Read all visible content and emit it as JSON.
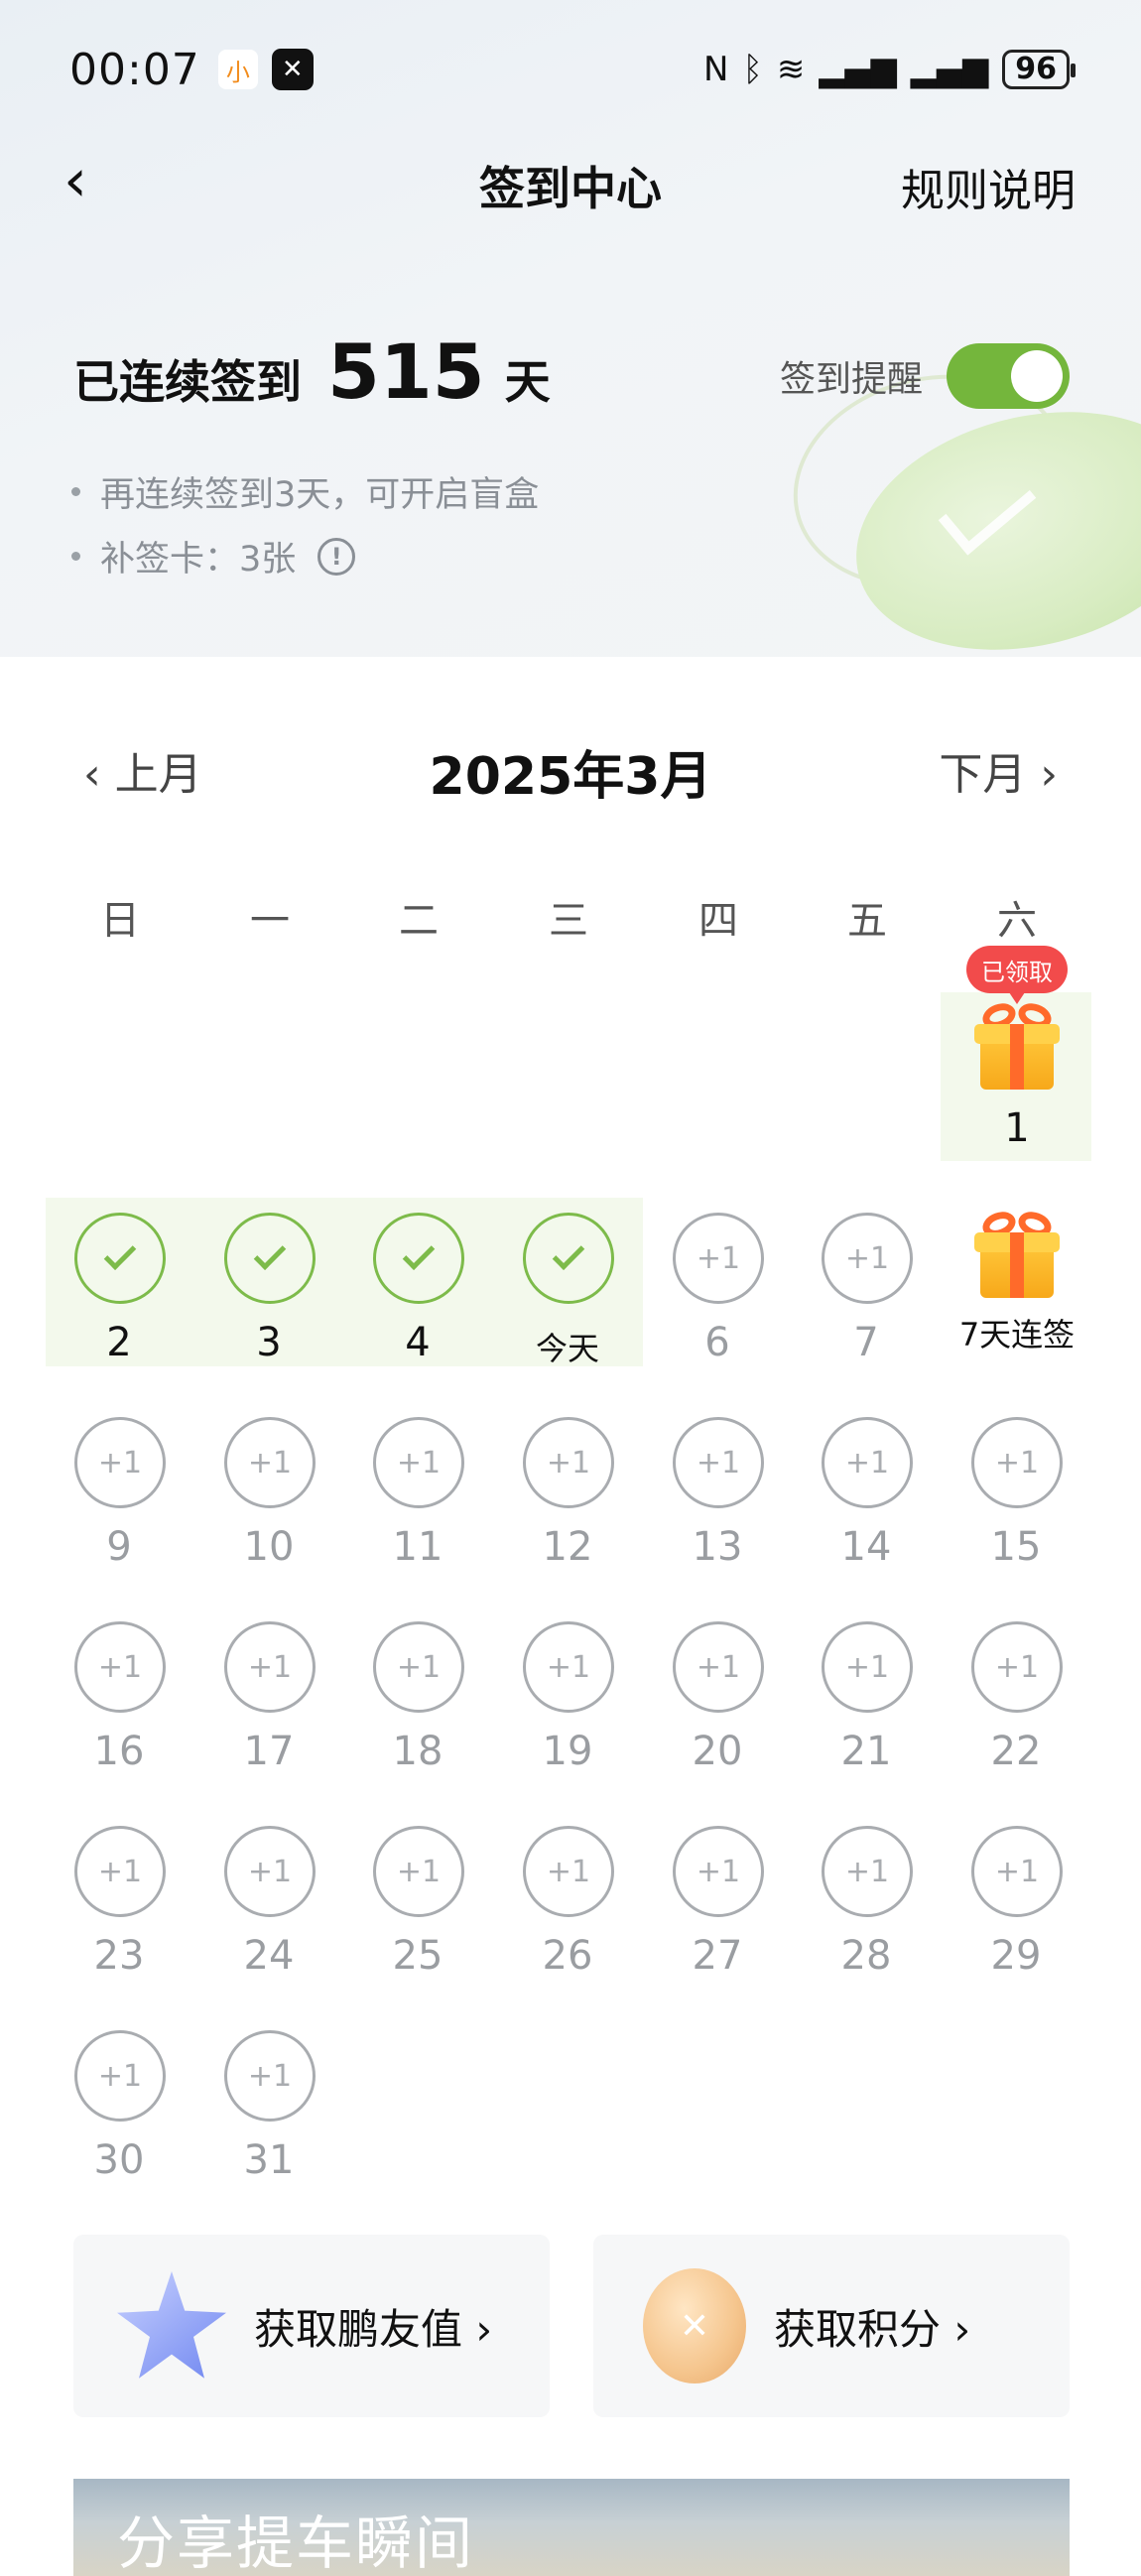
{
  "status": {
    "time": "00:07",
    "app1": "小",
    "app2": "✕",
    "nfc": "N",
    "bluetooth": "ᛒ",
    "wifi": "≋",
    "signal1": "▂▄▆",
    "signal2": "▂▄▆",
    "battery": "96"
  },
  "nav": {
    "back": "‹",
    "title": "签到中心",
    "rules": "规则说明"
  },
  "streak": {
    "label": "已连续签到",
    "days": "515",
    "unit": "天"
  },
  "reminder": {
    "label": "签到提醒",
    "on": true
  },
  "info": {
    "blind_box": "再连续签到3天，可开启盲盒",
    "makeup_card": "补签卡：3张",
    "info_icon": "!"
  },
  "calendar": {
    "prev": "‹ 上月",
    "title": "2025年3月",
    "next": "下月 ›",
    "weekdays": [
      "日",
      "一",
      "二",
      "三",
      "四",
      "五",
      "六"
    ],
    "claimed_badge": "已领取",
    "day1": "1",
    "seven_day_label": "7天连签",
    "plus": "+1",
    "checked_days": [
      "2",
      "3",
      "4",
      "今天"
    ],
    "days": [
      "6",
      "7",
      "9",
      "10",
      "11",
      "12",
      "13",
      "14",
      "15",
      "16",
      "17",
      "18",
      "19",
      "20",
      "21",
      "22",
      "23",
      "24",
      "25",
      "26",
      "27",
      "28",
      "29",
      "30",
      "31"
    ]
  },
  "cards": {
    "friend_value": "获取鹏友值 ›",
    "points": "获取积分 ›"
  },
  "banner": {
    "text": "分享提车瞬间"
  },
  "colors": {
    "accent_green": "#74b63c",
    "check_green": "#7dbb4a",
    "badge_red": "#f24b4b"
  }
}
